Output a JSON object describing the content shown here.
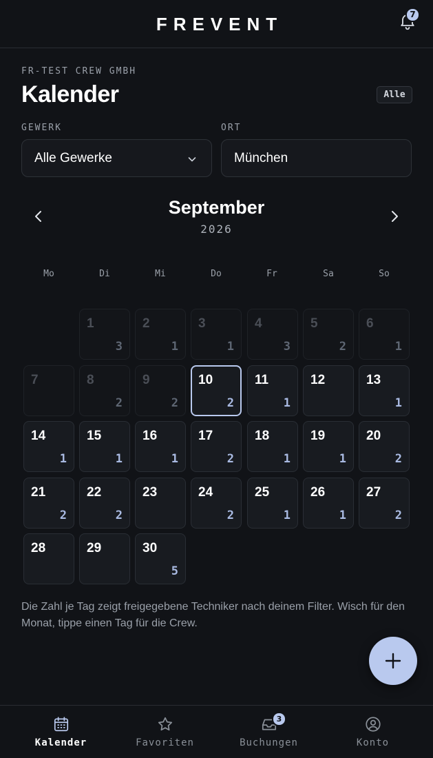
{
  "header": {
    "brand": "FREVENT",
    "notification_count": "7"
  },
  "company": "FR-TEST CREW GMBH",
  "page_title": "Kalender",
  "filter_chip": "Alle",
  "filters": {
    "trade": {
      "label": "GEWERK",
      "value": "Alle Gewerke"
    },
    "location": {
      "label": "ORT",
      "value": "München"
    }
  },
  "calendar": {
    "month": "September",
    "year": "2026",
    "weekdays": [
      "Mo",
      "Di",
      "Mi",
      "Do",
      "Fr",
      "Sa",
      "So"
    ],
    "first_weekday_offset": 1,
    "today": 10,
    "days": [
      {
        "day": "1",
        "count": "3",
        "past": true
      },
      {
        "day": "2",
        "count": "1",
        "past": true
      },
      {
        "day": "3",
        "count": "1",
        "past": true
      },
      {
        "day": "4",
        "count": "3",
        "past": true
      },
      {
        "day": "5",
        "count": "2",
        "past": true
      },
      {
        "day": "6",
        "count": "1",
        "past": true
      },
      {
        "day": "7",
        "count": "",
        "past": true
      },
      {
        "day": "8",
        "count": "2",
        "past": true
      },
      {
        "day": "9",
        "count": "2",
        "past": true
      },
      {
        "day": "10",
        "count": "2",
        "past": false
      },
      {
        "day": "11",
        "count": "1",
        "past": false
      },
      {
        "day": "12",
        "count": "",
        "past": false
      },
      {
        "day": "13",
        "count": "1",
        "past": false
      },
      {
        "day": "14",
        "count": "1",
        "past": false
      },
      {
        "day": "15",
        "count": "1",
        "past": false
      },
      {
        "day": "16",
        "count": "1",
        "past": false
      },
      {
        "day": "17",
        "count": "2",
        "past": false
      },
      {
        "day": "18",
        "count": "1",
        "past": false
      },
      {
        "day": "19",
        "count": "1",
        "past": false
      },
      {
        "day": "20",
        "count": "2",
        "past": false
      },
      {
        "day": "21",
        "count": "2",
        "past": false
      },
      {
        "day": "22",
        "count": "2",
        "past": false
      },
      {
        "day": "23",
        "count": "",
        "past": false
      },
      {
        "day": "24",
        "count": "2",
        "past": false
      },
      {
        "day": "25",
        "count": "1",
        "past": false
      },
      {
        "day": "26",
        "count": "1",
        "past": false
      },
      {
        "day": "27",
        "count": "2",
        "past": false
      },
      {
        "day": "28",
        "count": "",
        "past": false
      },
      {
        "day": "29",
        "count": "",
        "past": false
      },
      {
        "day": "30",
        "count": "5",
        "past": false
      }
    ]
  },
  "hint": "Die Zahl je Tag zeigt freigegebene Techniker nach deinem Filter. Wisch für den Monat, tippe einen Tag für die Crew.",
  "bottom_nav": {
    "items": [
      {
        "label": "Kalender",
        "icon": "calendar-icon",
        "active": true
      },
      {
        "label": "Favoriten",
        "icon": "star-icon",
        "active": false
      },
      {
        "label": "Buchungen",
        "icon": "inbox-icon",
        "active": false,
        "badge": "3"
      },
      {
        "label": "Konto",
        "icon": "user-circle-icon",
        "active": false
      }
    ]
  },
  "colors": {
    "background": "#111317",
    "accent": "#b9c9ee",
    "cell": "#181b20"
  }
}
